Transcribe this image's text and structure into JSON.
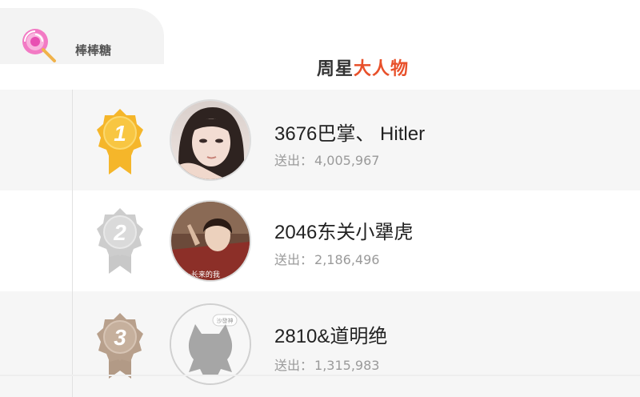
{
  "gift_tab": {
    "icon": "lollipop-icon",
    "name": "棒棒糖"
  },
  "title": {
    "part1": "周星",
    "part2": "大人物"
  },
  "rankings": [
    {
      "rank": "1",
      "medal": "gold-medal-icon",
      "name": "3676巴掌、 Hitler",
      "sent_label": "送出：",
      "sent_value": "4,005,967"
    },
    {
      "rank": "2",
      "medal": "silver-medal-icon",
      "name": "2046东关小犟虎",
      "sent_label": "送出：",
      "sent_value": "2,186,496"
    },
    {
      "rank": "3",
      "medal": "bronze-medal-icon",
      "name": "2810&道明绝",
      "sent_label": "送出：",
      "sent_value": "1,315,983"
    }
  ],
  "avatar3_caption": "沙發神",
  "colors": {
    "gold": "#f5b62a",
    "silver": "#c8c8c8",
    "bronze": "#b8a08c",
    "title_highlight": "#e8502a"
  }
}
